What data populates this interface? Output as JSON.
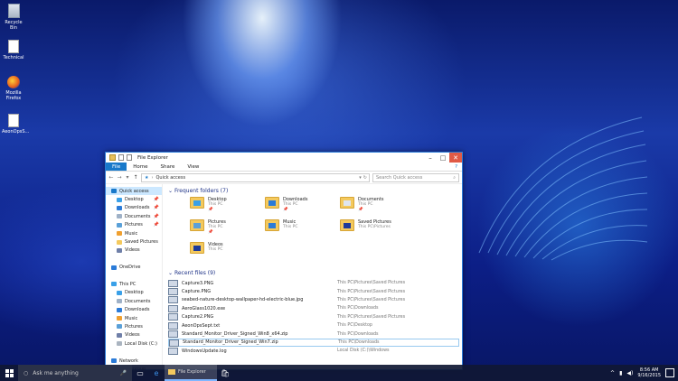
{
  "desktop": {
    "icons": [
      {
        "label": "Recycle Bin",
        "icon": "recycle-bin-icon"
      },
      {
        "label": "Technical",
        "icon": "document-icon"
      },
      {
        "label": "Mozilla Firefox",
        "icon": "firefox-icon"
      },
      {
        "label": "AeonOpsS...",
        "icon": "document-icon"
      }
    ]
  },
  "window": {
    "title": "File Explorer",
    "ribbon": {
      "file": "File",
      "home": "Home",
      "share": "Share",
      "view": "View",
      "help": "?"
    },
    "address": {
      "location": "Quick access",
      "search_placeholder": "Search Quick access"
    },
    "sidebar": [
      {
        "label": "Quick access",
        "pinned": false,
        "selected": true,
        "color": "#1979ca"
      },
      {
        "label": "Desktop",
        "pinned": true,
        "color": "#3aa0e8"
      },
      {
        "label": "Downloads",
        "pinned": true,
        "color": "#2b7bd8"
      },
      {
        "label": "Documents",
        "pinned": true,
        "color": "#9fb1c7"
      },
      {
        "label": "Pictures",
        "pinned": true,
        "color": "#5aa0d8"
      },
      {
        "label": "Music",
        "pinned": false,
        "color": "#f0a030"
      },
      {
        "label": "Saved Pictures",
        "pinned": false,
        "color": "#f4c95d"
      },
      {
        "label": "Videos",
        "pinned": false,
        "color": "#6f7fa8"
      },
      {
        "label": "",
        "pinned": false,
        "color": ""
      },
      {
        "label": "OneDrive",
        "pinned": false,
        "color": "#2b7bd8"
      },
      {
        "label": "",
        "pinned": false,
        "color": ""
      },
      {
        "label": "This PC",
        "pinned": false,
        "color": "#3aa0e8"
      },
      {
        "label": "Desktop",
        "pinned": false,
        "color": "#3aa0e8"
      },
      {
        "label": "Documents",
        "pinned": false,
        "color": "#9fb1c7"
      },
      {
        "label": "Downloads",
        "pinned": false,
        "color": "#2b7bd8"
      },
      {
        "label": "Music",
        "pinned": false,
        "color": "#f0a030"
      },
      {
        "label": "Pictures",
        "pinned": false,
        "color": "#5aa0d8"
      },
      {
        "label": "Videos",
        "pinned": false,
        "color": "#6f7fa8"
      },
      {
        "label": "Local Disk (C:)",
        "pinned": false,
        "color": "#aab4c0"
      },
      {
        "label": "",
        "pinned": false,
        "color": ""
      },
      {
        "label": "Network",
        "pinned": false,
        "color": "#2b7bd8"
      },
      {
        "label": "Homegroup",
        "pinned": false,
        "color": "#2b7bd8"
      }
    ],
    "frequent_header": "Frequent folders (7)",
    "frequent": [
      {
        "name": "Desktop",
        "sub": "This PC",
        "pinned": true,
        "overlay": "#3aa0e8"
      },
      {
        "name": "Downloads",
        "sub": "This PC",
        "pinned": true,
        "overlay": "#2b7bd8"
      },
      {
        "name": "Documents",
        "sub": "This PC",
        "pinned": true,
        "overlay": "#dfe5ee"
      },
      {
        "name": "Pictures",
        "sub": "This PC",
        "pinned": true,
        "overlay": "#5aa0d8"
      },
      {
        "name": "Music",
        "sub": "This PC",
        "pinned": false,
        "overlay": "#2b7bd8"
      },
      {
        "name": "Saved Pictures",
        "sub": "This PC\\Pictures",
        "pinned": false,
        "overlay": "#1d3a9a"
      },
      {
        "name": "Videos",
        "sub": "This PC",
        "pinned": false,
        "overlay": "#1d3a9a"
      }
    ],
    "recent_header": "Recent files (9)",
    "recent": [
      {
        "name": "Capture3.PNG",
        "path": "This PC\\Pictures\\Saved Pictures"
      },
      {
        "name": "Capture.PNG",
        "path": "This PC\\Pictures\\Saved Pictures"
      },
      {
        "name": "seabed-nature-desktop-wallpaper-hd-electric-blue.jpg",
        "path": "This PC\\Pictures\\Saved Pictures"
      },
      {
        "name": "AeroGlass1020.exe",
        "path": "This PC\\Downloads"
      },
      {
        "name": "Capture2.PNG",
        "path": "This PC\\Pictures\\Saved Pictures"
      },
      {
        "name": "AeonOpsSept.txt",
        "path": "This PC\\Desktop"
      },
      {
        "name": "Standard_Monitor_Driver_Signed_Win8_x64.zip",
        "path": "This PC\\Downloads"
      },
      {
        "name": "Standard_Monitor_Driver_Signed_Win7.zip",
        "path": "This PC\\Downloads"
      },
      {
        "name": "WindowsUpdate.log",
        "path": "Local Disk (C:)\\Windows"
      }
    ]
  },
  "taskbar": {
    "search_placeholder": "Ask me anything",
    "active_app": "File Explorer",
    "time": "8:56 AM",
    "date": "9/16/2015"
  }
}
